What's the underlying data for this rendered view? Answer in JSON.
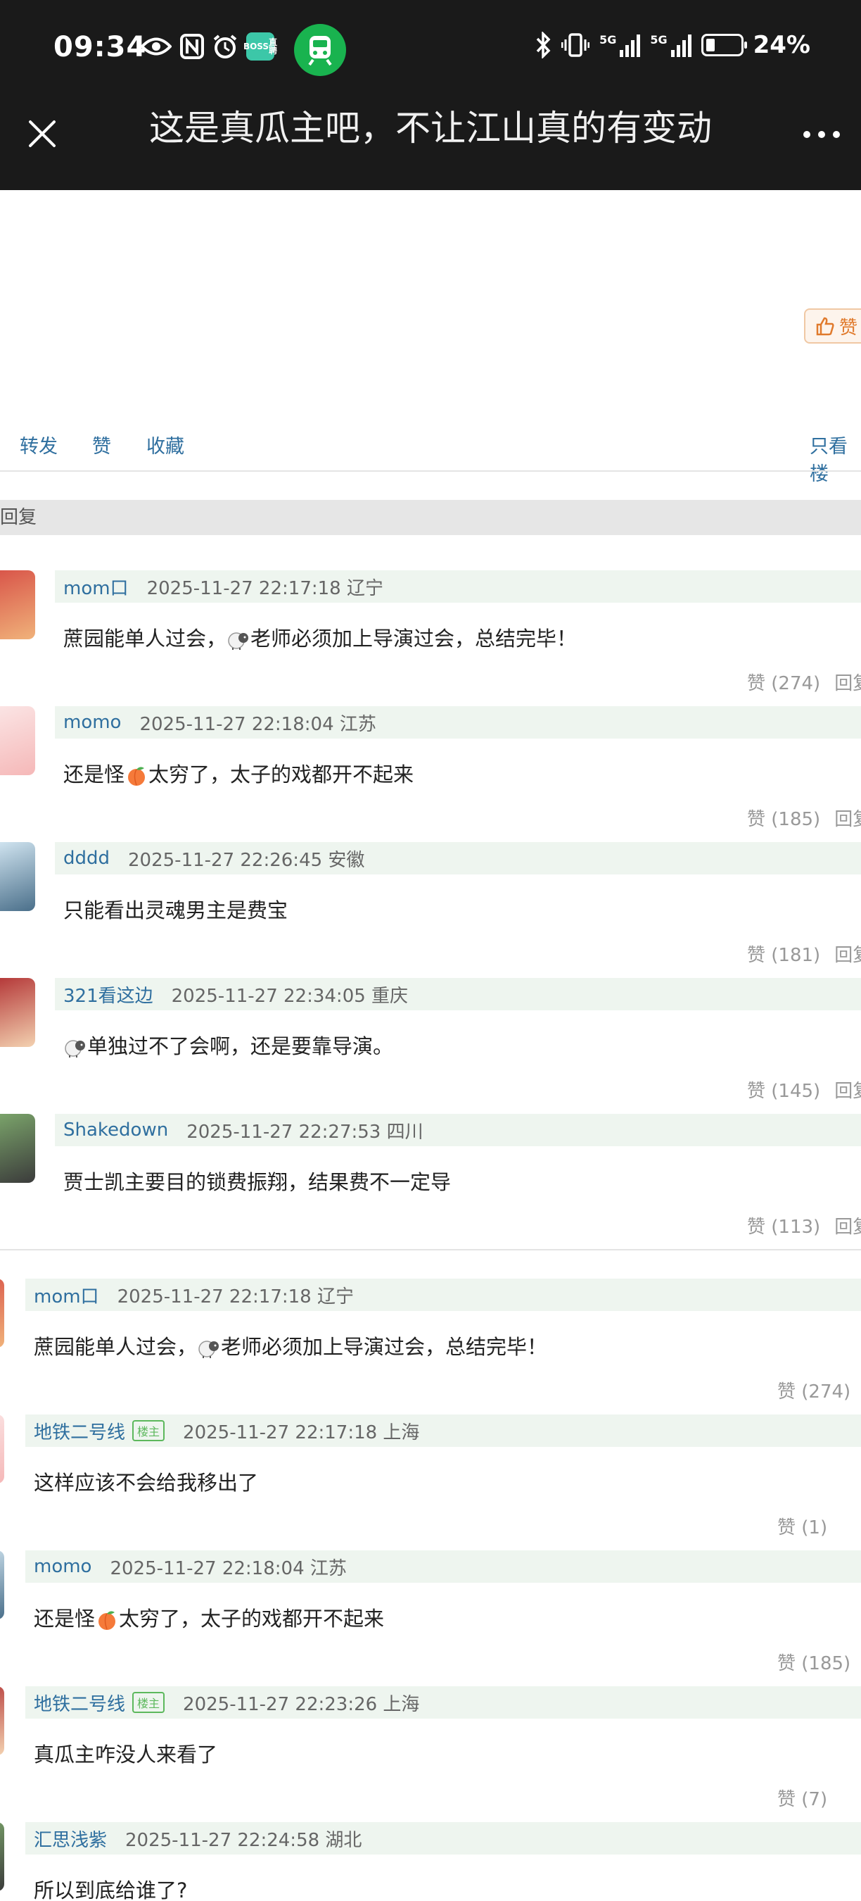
{
  "status_bar": {
    "time": "09:34",
    "battery": "24%",
    "network": [
      "5G",
      "5G"
    ],
    "boss_icon": [
      "BOSS",
      "直聘"
    ]
  },
  "title_bar": {
    "title": "这是真瓜主吧，不让江山真的有变动"
  },
  "post": {
    "like_chip": "赞",
    "actions": {
      "share": "转发",
      "like": "赞",
      "favorite": "收藏",
      "only_op": "只看楼"
    },
    "section_label": "回复"
  },
  "hot_comments": [
    {
      "user": "mom口",
      "meta": "2025-11-27 22:17:18 辽宁",
      "text": [
        "蔗园能单人过会，",
        "老师必须加上导演过会，总结完毕！"
      ],
      "emoji": "sheep",
      "likes": "赞 (274)",
      "reply": "回复"
    },
    {
      "user": "momo",
      "meta": "2025-11-27 22:18:04 江苏",
      "text": [
        "还是怪",
        "太穷了，太子的戏都开不起来"
      ],
      "emoji": "peach",
      "likes": "赞 (185)",
      "reply": "回复"
    },
    {
      "user": "dddd",
      "meta": "2025-11-27 22:26:45 安徽",
      "text": [
        "只能看出灵魂男主是费宝"
      ],
      "emoji": "",
      "likes": "赞 (181)",
      "reply": "回复"
    },
    {
      "user": "321看这边",
      "meta": "2025-11-27 22:34:05 重庆",
      "text": [
        "",
        "单独过不了会啊，还是要靠导演。"
      ],
      "emoji": "sheep",
      "likes": "赞 (145)",
      "reply": "回复"
    },
    {
      "user": "Shakedown",
      "meta": "2025-11-27 22:27:53 四川",
      "text": [
        "贾士凯主要目的锁费振翔，结果费不一定导"
      ],
      "emoji": "",
      "likes": "赞 (113)",
      "reply": "回复"
    }
  ],
  "all_comments": [
    {
      "user": "mom口",
      "badge": "",
      "meta": "2025-11-27 22:17:18 辽宁",
      "text": [
        "蔗园能单人过会，",
        "老师必须加上导演过会，总结完毕！"
      ],
      "emoji": "sheep",
      "likes": "赞 (274)"
    },
    {
      "user": "地铁二号线",
      "badge": "楼主",
      "meta": "2025-11-27 22:17:18 上海",
      "text": [
        "这样应该不会给我移出了"
      ],
      "emoji": "",
      "likes": "赞 (1)"
    },
    {
      "user": "momo",
      "badge": "",
      "meta": "2025-11-27 22:18:04 江苏",
      "text": [
        "还是怪",
        "太穷了，太子的戏都开不起来"
      ],
      "emoji": "peach",
      "likes": "赞 (185)"
    },
    {
      "user": "地铁二号线",
      "badge": "楼主",
      "meta": "2025-11-27 22:23:26 上海",
      "text": [
        "真瓜主咋没人来看了"
      ],
      "emoji": "",
      "likes": "赞 (7)"
    },
    {
      "user": "汇思浅紫",
      "badge": "",
      "meta": "2025-11-27 22:24:58 湖北",
      "text": [
        "所以到底给谁了?"
      ],
      "emoji": "",
      "likes": ""
    }
  ],
  "colors": {
    "link": "#2f6f9f",
    "header_bg": "#1a1a1a",
    "row_bg": "#eef5ef",
    "badge": "#5cb85c"
  }
}
